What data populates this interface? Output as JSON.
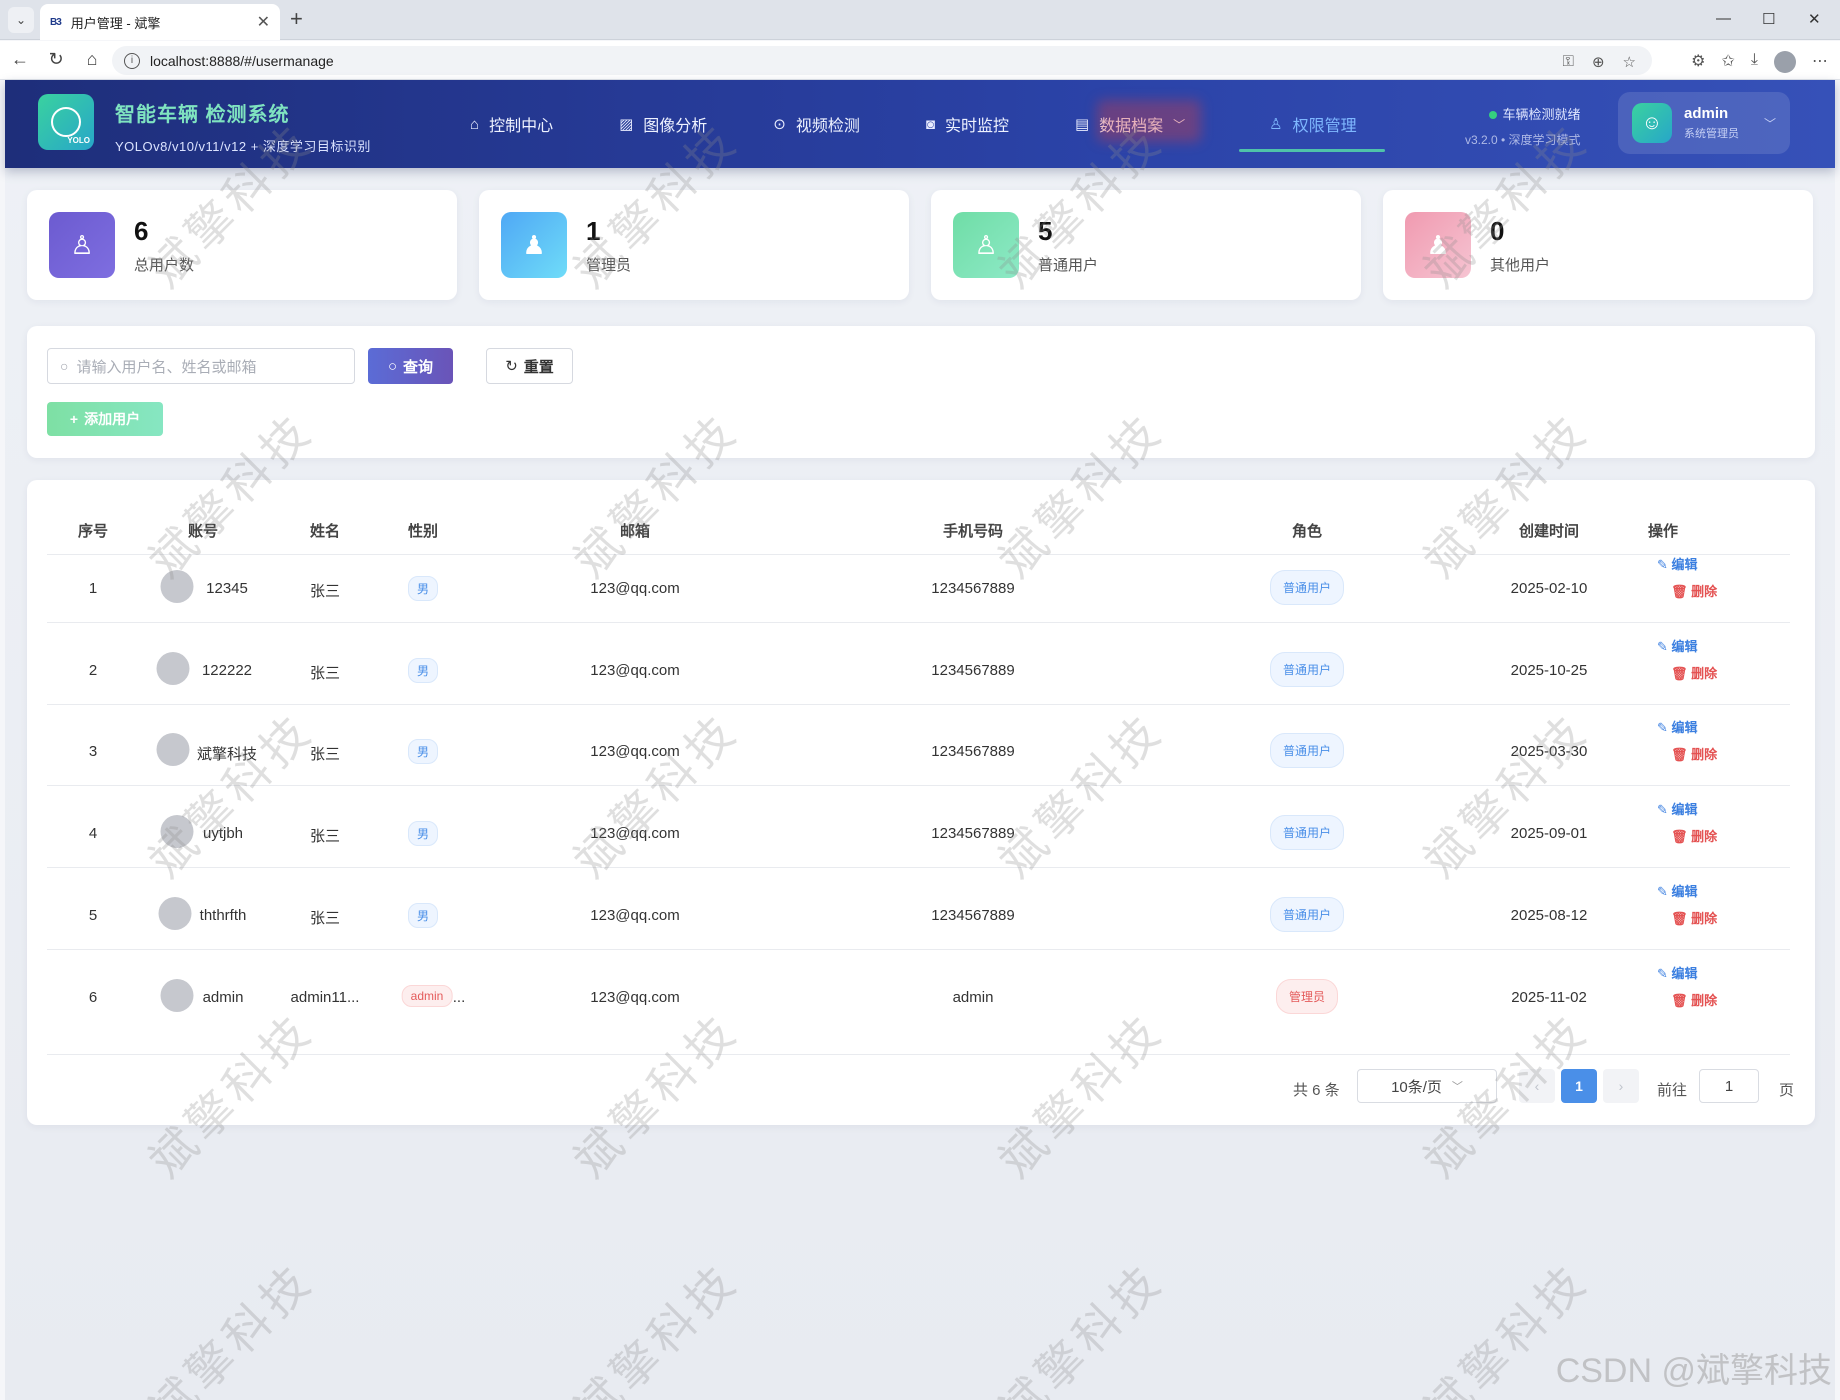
{
  "browser": {
    "tab_title": "用户管理 - 斌擎",
    "tab_favicon": "B3",
    "url": "localhost:8888/#/usermanage"
  },
  "header": {
    "brand_title": "智能车辆 检测系统",
    "brand_subtitle": "YOLOv8/v10/v11/v12 + 深度学习目标识别",
    "logo_text": "YOLO",
    "nav": [
      {
        "label": "控制中心",
        "icon": "home-icon"
      },
      {
        "label": "图像分析",
        "icon": "image-icon"
      },
      {
        "label": "视频检测",
        "icon": "play-icon"
      },
      {
        "label": "实时监控",
        "icon": "camera-icon"
      },
      {
        "label": "数据档案",
        "icon": "document-icon"
      },
      {
        "label": "权限管理",
        "icon": "user-icon",
        "active": true
      }
    ],
    "status_text": "车辆检测就绪",
    "version_text": "v3.2.0 • 深度学习模式",
    "user_name": "admin",
    "user_role": "系统管理员"
  },
  "stats": [
    {
      "value": "6",
      "label": "总用户数",
      "color": "#6c5bd0"
    },
    {
      "value": "1",
      "label": "管理员",
      "color": "#4fb6f5"
    },
    {
      "value": "5",
      "label": "普通用户",
      "color": "#6fdda6"
    },
    {
      "value": "0",
      "label": "其他用户",
      "color": "#f09ab0"
    }
  ],
  "search": {
    "placeholder": "请输入用户名、姓名或邮箱",
    "query_label": "查询",
    "reset_label": "重置",
    "add_label": "添加用户"
  },
  "table": {
    "columns": [
      "序号",
      "账号",
      "姓名",
      "性别",
      "邮箱",
      "手机号码",
      "角色",
      "创建时间",
      "操作"
    ],
    "edit_label": "编辑",
    "delete_label": "删除",
    "rows": [
      {
        "index": "1",
        "account": "12345",
        "name": "张三",
        "gender": "男",
        "email": "123@qq.com",
        "phone": "1234567889",
        "role": "普通用户",
        "created": "2025-02-10"
      },
      {
        "index": "2",
        "account": "122222",
        "name": "张三",
        "gender": "男",
        "email": "123@qq.com",
        "phone": "1234567889",
        "role": "普通用户",
        "created": "2025-10-25"
      },
      {
        "index": "3",
        "account": "斌擎科技",
        "name": "张三",
        "gender": "男",
        "email": "123@qq.com",
        "phone": "1234567889",
        "role": "普通用户",
        "created": "2025-03-30"
      },
      {
        "index": "4",
        "account": "uytjbh",
        "name": "张三",
        "gender": "男",
        "email": "123@qq.com",
        "phone": "1234567889",
        "role": "普通用户",
        "created": "2025-09-01"
      },
      {
        "index": "5",
        "account": "ththrfth",
        "name": "张三",
        "gender": "男",
        "email": "123@qq.com",
        "phone": "1234567889",
        "role": "普通用户",
        "created": "2025-08-12"
      },
      {
        "index": "6",
        "account": "admin",
        "name": "admin11...",
        "gender": "admin",
        "gender_extra": "...",
        "email": "123@qq.com",
        "phone": "admin",
        "role": "管理员",
        "created": "2025-11-02"
      }
    ]
  },
  "pagination": {
    "total_text": "共 6 条",
    "page_size": "10条/页",
    "current_page": "1",
    "goto_prefix": "前往",
    "goto_value": "1",
    "goto_suffix": "页"
  },
  "watermark": "斌擎科技",
  "footer_mark": "CSDN @斌擎科技"
}
